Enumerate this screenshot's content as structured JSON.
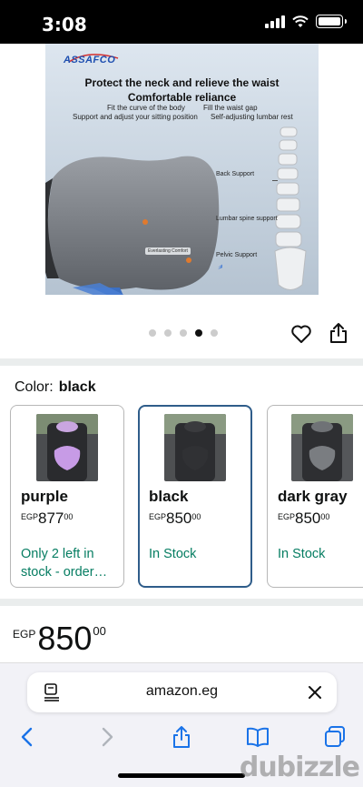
{
  "status_bar": {
    "time": "3:08"
  },
  "product_image": {
    "brand": "ASSAFCO",
    "headline1": "Protect the neck and relieve the waist",
    "headline2": "Comfortable reliance",
    "features": [
      "Fit the curve of the body",
      "Fill the waist gap",
      "Support and adjust your sitting position",
      "Self-adjusting lumbar rest"
    ],
    "callouts": [
      "Back Support",
      "Lumbar spine support",
      "Pelvic Support"
    ],
    "pillow_tag": "Everlasting Comfort"
  },
  "carousel": {
    "total": 5,
    "active_index": 3
  },
  "color": {
    "label": "Color:",
    "value": "black"
  },
  "swatches": [
    {
      "name": "purple",
      "currency": "EGP",
      "amount": "877",
      "cents": "00",
      "stock": "Only 2 left in stock - order…"
    },
    {
      "name": "black",
      "currency": "EGP",
      "amount": "850",
      "cents": "00",
      "stock": "In Stock"
    },
    {
      "name": "dark gray",
      "currency": "EGP",
      "amount": "850",
      "cents": "00",
      "stock": "In Stock"
    }
  ],
  "price": {
    "currency": "EGP",
    "amount": "850",
    "cents": "00"
  },
  "browser": {
    "url": "amazon.eg"
  },
  "watermark": "dubizzle",
  "colors": {
    "stock_green": "#067d62",
    "selected_border": "#2f5d8a",
    "accent_blue": "#1a73e8"
  }
}
